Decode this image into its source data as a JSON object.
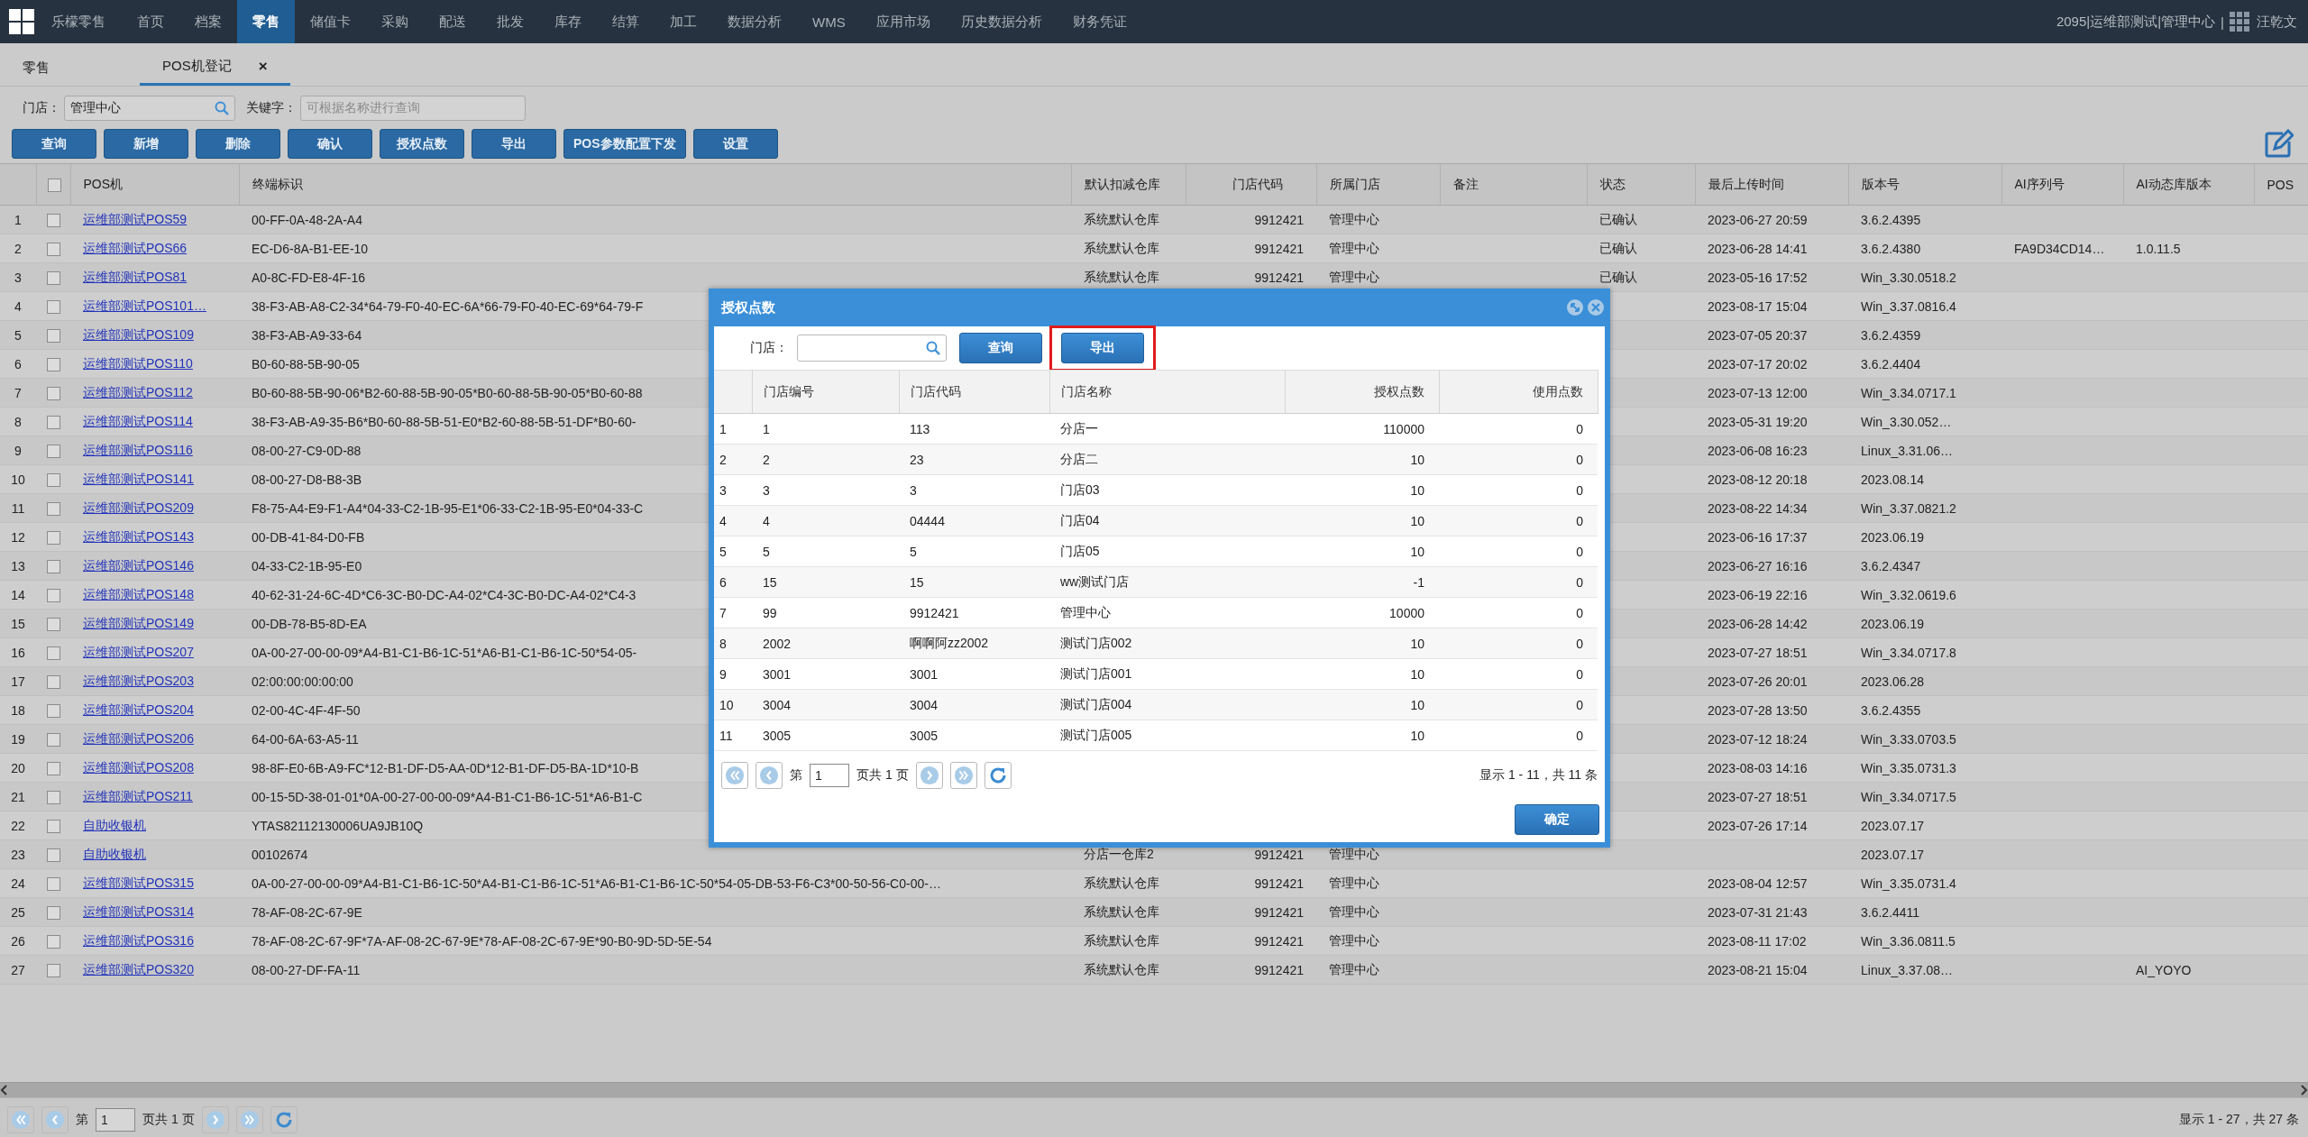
{
  "nav": {
    "brand": "乐檬零售",
    "items": [
      {
        "label": "首页",
        "selected": false
      },
      {
        "label": "档案",
        "selected": false
      },
      {
        "label": "零售",
        "selected": true
      },
      {
        "label": "储值卡",
        "selected": false
      },
      {
        "label": "采购",
        "selected": false
      },
      {
        "label": "配送",
        "selected": false
      },
      {
        "label": "批发",
        "selected": false
      },
      {
        "label": "库存",
        "selected": false
      },
      {
        "label": "结算",
        "selected": false
      },
      {
        "label": "加工",
        "selected": false
      },
      {
        "label": "数据分析",
        "selected": false
      },
      {
        "label": "WMS",
        "selected": false
      },
      {
        "label": "应用市场",
        "selected": false
      },
      {
        "label": "历史数据分析",
        "selected": false
      },
      {
        "label": "财务凭证",
        "selected": false
      }
    ],
    "account": "2095|运维部测试|管理中心",
    "separator": "|",
    "user": "汪乾文"
  },
  "tabs": [
    {
      "label": "零售",
      "selected": false
    },
    {
      "label": "POS机登记",
      "selected": true,
      "close": "×"
    }
  ],
  "filters": [
    {
      "label": "门店：",
      "value": "管理中心",
      "search": true
    },
    {
      "label": "关键字：",
      "placeholder": "可根据名称进行查询",
      "search": false
    }
  ],
  "toolbar": [
    "查询",
    "新增",
    "删除",
    "确认",
    "授权点数",
    "导出",
    "POS参数配置下发",
    "设置"
  ],
  "table": {
    "select_all": {
      "checked": false
    },
    "columns": [
      "POS机",
      "终端标识",
      "默认扣减仓库",
      "门店代码",
      "所属门店",
      "备注",
      "状态",
      "最后上传时间",
      "版本号",
      "AI序列号",
      "AI动态库版本",
      "POS"
    ],
    "rows": [
      {
        "num": "1",
        "checked": false,
        "pos": "运维部测试POS59",
        "terminal": "00-FF-0A-48-2A-A4",
        "warehouse": "系统默认仓库",
        "store_code": "9912421",
        "store": "管理中心",
        "status": "已确认",
        "upload_time": "2023-06-27 20:59",
        "version": "3.6.2.4395"
      },
      {
        "num": "2",
        "checked": false,
        "pos": "运维部测试POS66",
        "terminal": "EC-D6-8A-B1-EE-10",
        "warehouse": "系统默认仓库",
        "store_code": "9912421",
        "store": "管理中心",
        "status": "已确认",
        "upload_time": "2023-06-28 14:41",
        "version": "3.6.2.4380",
        "ai_serial": "FA9D34CD14…",
        "ai_lib": "1.0.11.5"
      },
      {
        "num": "3",
        "checked": false,
        "pos": "运维部测试POS81",
        "terminal": "A0-8C-FD-E8-4F-16",
        "warehouse": "系统默认仓库",
        "store_code": "9912421",
        "store": "管理中心",
        "status": "已确认",
        "upload_time": "2023-05-16 17:52",
        "version": "Win_3.30.0518.2"
      },
      {
        "num": "4",
        "checked": false,
        "pos": "运维部测试POS101…",
        "terminal": "38-F3-AB-A8-C2-34*64-79-F0-40-EC-6A*66-79-F0-40-EC-69*64-79-F",
        "upload_time": "2023-08-17 15:04",
        "version": "Win_3.37.0816.4"
      },
      {
        "num": "5",
        "checked": false,
        "pos": "运维部测试POS109",
        "terminal": "38-F3-AB-A9-33-64",
        "upload_time": "2023-07-05 20:37",
        "version": "3.6.2.4359"
      },
      {
        "num": "6",
        "checked": false,
        "pos": "运维部测试POS110",
        "terminal": "B0-60-88-5B-90-05",
        "upload_time": "2023-07-17 20:02",
        "version": "3.6.2.4404"
      },
      {
        "num": "7",
        "checked": false,
        "pos": "运维部测试POS112",
        "terminal": "B0-60-88-5B-90-06*B2-60-88-5B-90-05*B0-60-88-5B-90-05*B0-60-88",
        "upload_time": "2023-07-13 12:00",
        "version": "Win_3.34.0717.1"
      },
      {
        "num": "8",
        "checked": false,
        "pos": "运维部测试POS114",
        "terminal": "38-F3-AB-A9-35-B6*B0-60-88-5B-51-E0*B2-60-88-5B-51-DF*B0-60-",
        "upload_time": "2023-05-31 19:20",
        "version": "Win_3.30.052…"
      },
      {
        "num": "9",
        "checked": false,
        "pos": "运维部测试POS116",
        "terminal": "08-00-27-C9-0D-88",
        "upload_time": "2023-06-08 16:23",
        "version": "Linux_3.31.06…"
      },
      {
        "num": "10",
        "checked": false,
        "pos": "运维部测试POS141",
        "terminal": "08-00-27-D8-B8-3B",
        "upload_time": "2023-08-12 20:18",
        "version": "2023.08.14"
      },
      {
        "num": "11",
        "checked": false,
        "pos": "运维部测试POS209",
        "terminal": "F8-75-A4-E9-F1-A4*04-33-C2-1B-95-E1*06-33-C2-1B-95-E0*04-33-C",
        "upload_time": "2023-08-22 14:34",
        "version": "Win_3.37.0821.2"
      },
      {
        "num": "12",
        "checked": false,
        "pos": "运维部测试POS143",
        "terminal": "00-DB-41-84-D0-FB",
        "upload_time": "2023-06-16 17:37",
        "version": "2023.06.19"
      },
      {
        "num": "13",
        "checked": false,
        "pos": "运维部测试POS146",
        "terminal": "04-33-C2-1B-95-E0",
        "upload_time": "2023-06-27 16:16",
        "version": "3.6.2.4347"
      },
      {
        "num": "14",
        "checked": false,
        "pos": "运维部测试POS148",
        "terminal": "40-62-31-24-6C-4D*C6-3C-B0-DC-A4-02*C4-3C-B0-DC-A4-02*C4-3",
        "upload_time": "2023-06-19 22:16",
        "version": "Win_3.32.0619.6"
      },
      {
        "num": "15",
        "checked": false,
        "pos": "运维部测试POS149",
        "terminal": "00-DB-78-B5-8D-EA",
        "upload_time": "2023-06-28 14:42",
        "version": "2023.06.19"
      },
      {
        "num": "16",
        "checked": false,
        "pos": "运维部测试POS207",
        "terminal": "0A-00-27-00-00-09*A4-B1-C1-B6-1C-51*A6-B1-C1-B6-1C-50*54-05-",
        "upload_time": "2023-07-27 18:51",
        "version": "Win_3.34.0717.8"
      },
      {
        "num": "17",
        "checked": false,
        "pos": "运维部测试POS203",
        "terminal": "02:00:00:00:00:00",
        "upload_time": "2023-07-26 20:01",
        "version": "2023.06.28"
      },
      {
        "num": "18",
        "checked": false,
        "pos": "运维部测试POS204",
        "terminal": "02-00-4C-4F-4F-50",
        "upload_time": "2023-07-28 13:50",
        "version": "3.6.2.4355"
      },
      {
        "num": "19",
        "checked": false,
        "pos": "运维部测试POS206",
        "terminal": "64-00-6A-63-A5-11",
        "upload_time": "2023-07-12 18:24",
        "version": "Win_3.33.0703.5"
      },
      {
        "num": "20",
        "checked": false,
        "pos": "运维部测试POS208",
        "terminal": "98-8F-E0-6B-A9-FC*12-B1-DF-D5-AA-0D*12-B1-DF-D5-BA-1D*10-B",
        "upload_time": "2023-08-03 14:16",
        "version": "Win_3.35.0731.3"
      },
      {
        "num": "21",
        "checked": false,
        "pos": "运维部测试POS211",
        "terminal": "00-15-5D-38-01-01*0A-00-27-00-00-09*A4-B1-C1-B6-1C-51*A6-B1-C",
        "upload_time": "2023-07-27 18:51",
        "version": "Win_3.34.0717.5"
      },
      {
        "num": "22",
        "checked": false,
        "pos": "自助收银机",
        "terminal": "YTAS82112130006UA9JB10Q",
        "upload_time": "2023-07-26 17:14",
        "version": "2023.07.17"
      },
      {
        "num": "23",
        "checked": false,
        "pos": "自助收银机",
        "terminal": "00102674",
        "warehouse": "分店一仓库2",
        "store_code": "9912421",
        "store": "管理中心",
        "version": "2023.07.17"
      },
      {
        "num": "24",
        "checked": false,
        "pos": "运维部测试POS315",
        "terminal": "0A-00-27-00-00-09*A4-B1-C1-B6-1C-50*A4-B1-C1-B6-1C-51*A6-B1-C1-B6-1C-50*54-05-DB-53-F6-C3*00-50-56-C0-00-…",
        "warehouse": "系统默认仓库",
        "store_code": "9912421",
        "store": "管理中心",
        "upload_time": "2023-08-04 12:57",
        "version": "Win_3.35.0731.4"
      },
      {
        "num": "25",
        "checked": false,
        "pos": "运维部测试POS314",
        "terminal": "78-AF-08-2C-67-9E",
        "warehouse": "系统默认仓库",
        "store_code": "9912421",
        "store": "管理中心",
        "upload_time": "2023-07-31 21:43",
        "version": "3.6.2.4411"
      },
      {
        "num": "26",
        "checked": false,
        "pos": "运维部测试POS316",
        "terminal": "78-AF-08-2C-67-9F*7A-AF-08-2C-67-9E*78-AF-08-2C-67-9E*90-B0-9D-5D-5E-54",
        "warehouse": "系统默认仓库",
        "store_code": "9912421",
        "store": "管理中心",
        "upload_time": "2023-08-11 17:02",
        "version": "Win_3.36.0811.5"
      },
      {
        "num": "27",
        "checked": false,
        "pos": "运维部测试POS320",
        "terminal": "08-00-27-DF-FA-11",
        "warehouse": "系统默认仓库",
        "store_code": "9912421",
        "store": "管理中心",
        "upload_time": "2023-08-21 15:04",
        "version": "Linux_3.37.08…",
        "ai_lib": "AI_YOYO"
      }
    ]
  },
  "pager": {
    "page_label": "第",
    "page": "1",
    "total_label": "页共 1 页",
    "summary": "显示 1 - 27，共 27 条"
  },
  "dialog": {
    "title": "授权点数",
    "filter_label": "门店：",
    "buttons": [
      {
        "label": "查询",
        "highlighted": false
      },
      {
        "label": "导出",
        "highlighted": true
      }
    ],
    "columns": [
      "",
      "门店编号",
      "门店代码",
      "门店名称",
      "授权点数",
      "使用点数"
    ],
    "rows": [
      [
        "1",
        "1",
        "113",
        "分店一",
        "110000",
        "0"
      ],
      [
        "2",
        "2",
        "23",
        "分店二",
        "10",
        "0"
      ],
      [
        "3",
        "3",
        "3",
        "门店03",
        "10",
        "0"
      ],
      [
        "4",
        "4",
        "04444",
        "门店04",
        "10",
        "0"
      ],
      [
        "5",
        "5",
        "5",
        "门店05",
        "10",
        "0"
      ],
      [
        "6",
        "15",
        "15",
        "ww测试门店",
        "-1",
        "0"
      ],
      [
        "7",
        "99",
        "9912421",
        "管理中心",
        "10000",
        "0"
      ],
      [
        "8",
        "2002",
        "啊啊阿zz2002",
        "测试门店002",
        "10",
        "0"
      ],
      [
        "9",
        "3001",
        "3001",
        "测试门店001",
        "10",
        "0"
      ],
      [
        "10",
        "3004",
        "3004",
        "测试门店004",
        "10",
        "0"
      ],
      [
        "11",
        "3005",
        "3005",
        "测试门店005",
        "10",
        "0"
      ]
    ],
    "pager": {
      "page_label": "第",
      "page": "1",
      "total_label": "页共 1 页",
      "summary": "显示 1 - 11，共 11 条"
    },
    "confirm": "确定"
  }
}
